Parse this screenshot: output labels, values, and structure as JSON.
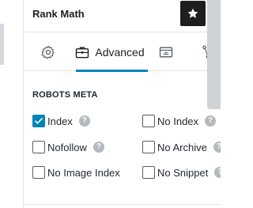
{
  "header": {
    "title": "Rank Math",
    "star_icon": "star-icon",
    "close_icon": "close-icon",
    "close_glyph": "×"
  },
  "tabs": [
    {
      "id": "general",
      "label": "",
      "icon": "gear-icon"
    },
    {
      "id": "advanced",
      "label": "Advanced",
      "icon": "briefcase-icon",
      "active": true
    },
    {
      "id": "schema",
      "label": "",
      "icon": "schema-icon"
    },
    {
      "id": "social",
      "label": "",
      "icon": "social-share-icon"
    }
  ],
  "robots_meta": {
    "title": "ROBOTS META",
    "help_glyph": "?",
    "options": [
      {
        "label": "Index",
        "checked": true
      },
      {
        "label": "No Index",
        "checked": false
      },
      {
        "label": "Nofollow",
        "checked": false
      },
      {
        "label": "No Archive",
        "checked": false
      },
      {
        "label": "No Image Index",
        "checked": false
      },
      {
        "label": "No Snippet",
        "checked": false
      }
    ]
  },
  "colors": {
    "accent": "#0085ba",
    "dark": "#1e1e1e",
    "help": "#b4b9be"
  }
}
